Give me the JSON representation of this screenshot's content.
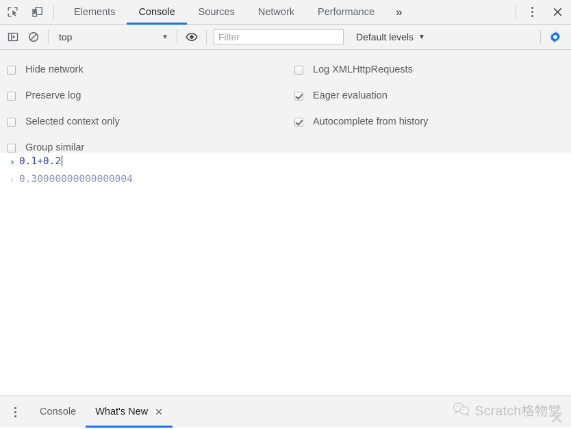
{
  "window": {
    "app": "Chrome DevTools",
    "close_label": "✕"
  },
  "tabbar": {
    "inspect_icon": "inspect-element-icon",
    "device_icon": "device-toolbar-icon",
    "tabs": [
      {
        "label": "Elements",
        "active": false
      },
      {
        "label": "Console",
        "active": true
      },
      {
        "label": "Sources",
        "active": false
      },
      {
        "label": "Network",
        "active": false
      },
      {
        "label": "Performance",
        "active": false
      }
    ],
    "overflow_label": "»",
    "more_icon": "kebab-menu-icon",
    "close_icon": "close-icon"
  },
  "console_toolbar": {
    "sidebar_toggle_icon": "console-sidebar-icon",
    "clear_icon": "clear-console-icon",
    "context": {
      "value": "top",
      "caret": "▼"
    },
    "eye_icon": "live-expression-eye-icon",
    "filter": {
      "value": "",
      "placeholder": "Filter"
    },
    "levels": {
      "label": "Default levels",
      "caret": "▼"
    },
    "settings_icon": "gear-icon",
    "settings_color": "#1a73e8"
  },
  "settings_panel": {
    "left": [
      {
        "label": "Hide network",
        "checked": false
      },
      {
        "label": "Preserve log",
        "checked": false
      },
      {
        "label": "Selected context only",
        "checked": false
      },
      {
        "label": "Group similar",
        "checked": false
      }
    ],
    "right": [
      {
        "label": "Log XMLHttpRequests",
        "checked": false
      },
      {
        "label": "Eager evaluation",
        "checked": true
      },
      {
        "label": "Autocomplete from history",
        "checked": true
      }
    ]
  },
  "console": {
    "prompt_glyph": "›",
    "input_expression": "0.1+0.2",
    "result_glyph": "‹",
    "result_value": "0.30000000000000004",
    "expression_color": "#303f9f",
    "result_color": "#8d8fb3"
  },
  "drawer": {
    "menu_icon": "kebab-menu-icon",
    "tabs": [
      {
        "label": "Console",
        "active": false,
        "closable": false
      },
      {
        "label": "What's New",
        "active": true,
        "closable": true
      }
    ],
    "close_glyph": "✕"
  },
  "watermark": {
    "icon": "wechat-icon",
    "text": "Scratch格物堂",
    "close_glyph": "✕"
  }
}
